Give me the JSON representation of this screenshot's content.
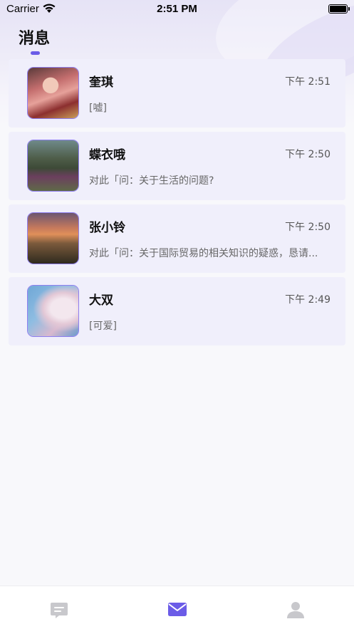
{
  "status_bar": {
    "carrier": "Carrier",
    "time": "2:51 PM"
  },
  "header": {
    "title": "消息"
  },
  "conversations": [
    {
      "name": "奎琪",
      "time": "下午 2:51",
      "preview": "[嘘]"
    },
    {
      "name": "蝶衣哦",
      "time": "下午 2:50",
      "preview": "对此「问：关于生活的问题?"
    },
    {
      "name": "张小铃",
      "time": "下午 2:50",
      "preview": "对此「问：关于国际贸易的相关知识的疑惑，恳请..."
    },
    {
      "name": "大双",
      "time": "下午 2:49",
      "preview": "[可爱]"
    }
  ],
  "tab_bar": {
    "items": [
      {
        "icon": "chat-bubble-icon",
        "active": false
      },
      {
        "icon": "mail-icon",
        "active": true
      },
      {
        "icon": "person-icon",
        "active": false
      }
    ]
  },
  "colors": {
    "accent": "#6b5ce7",
    "card_bg": "#f0effb",
    "inactive_icon": "#c8c8cc"
  }
}
